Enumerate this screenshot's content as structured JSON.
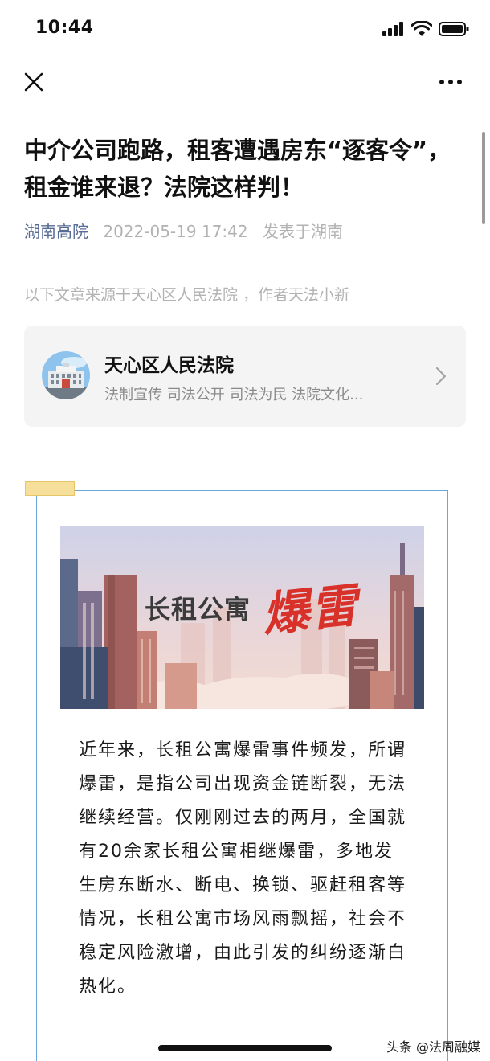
{
  "status_bar": {
    "time": "10:44"
  },
  "nav": {
    "close_icon": "close-icon",
    "more_icon": "more-icon"
  },
  "article": {
    "title": "中介公司跑路，租客遭遇房东“逐客令”，租金谁来退？法院这样判！",
    "author": "湖南高院",
    "datetime": "2022-05-19 17:42",
    "location": "发表于湖南",
    "source_note": "以下文章来源于天心区人民法院 ，作者天法小新"
  },
  "account": {
    "name": "天心区人民法院",
    "description": "法制宣传 司法公开 司法为民 法院文化..."
  },
  "banner": {
    "text_main": "长租公寓",
    "text_highlight": "爆雷"
  },
  "body": {
    "paragraph": "近年来，长租公寓爆雷事件频发，所谓爆雷，是指公司出现资金链断裂，无法继续经营。仅刚刚过去的两月，全国就有20余家长租公寓相继爆雷，多地发生房东断水、断电、换锁、驱赶租客等情况，长租公寓市场风雨飘摇，社会不稳定风险激增，由此引发的纠纷逐渐白热化。"
  },
  "watermark": "头条 @法周融媒",
  "colors": {
    "link_blue": "#576b95",
    "frame_blue": "#6aa8dc",
    "highlight_red": "#d8312a"
  }
}
